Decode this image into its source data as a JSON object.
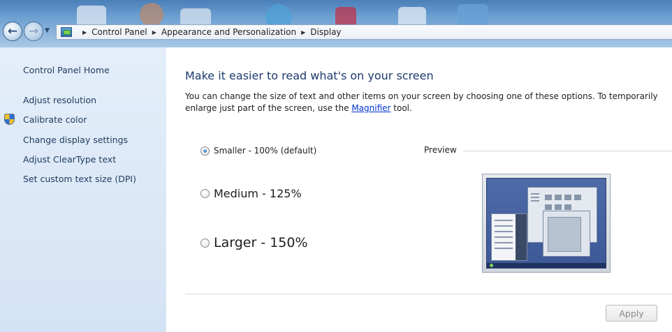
{
  "breadcrumb": {
    "items": [
      "Control Panel",
      "Appearance and Personalization",
      "Display"
    ]
  },
  "sidebar": {
    "home": "Control Panel Home",
    "items": [
      "Adjust resolution",
      "Calibrate color",
      "Change display settings",
      "Adjust ClearType text",
      "Set custom text size (DPI)"
    ]
  },
  "main": {
    "title": "Make it easier to read what's on your screen",
    "description_before": "You can change the size of text and other items on your screen by choosing one of these options. To temporarily enlarge just part of the screen, use the ",
    "magnifier_link": "Magnifier",
    "description_after": " tool.",
    "options": [
      {
        "label": "Smaller - 100% (default)",
        "selected": true
      },
      {
        "label": "Medium - 125%",
        "selected": false
      },
      {
        "label": "Larger - 150%",
        "selected": false
      }
    ],
    "preview_label": "Preview",
    "apply_label": "Apply"
  },
  "icons": {
    "back": "back-arrow-icon",
    "forward": "forward-arrow-icon",
    "control_panel": "control-panel-icon",
    "breadcrumb_separator": "triangle-right-icon",
    "shield": "uac-shield-icon"
  },
  "colors": {
    "sidebar_bg": "#dbe8f6",
    "title_text": "#1e3b6e",
    "link": "#0033cc"
  }
}
